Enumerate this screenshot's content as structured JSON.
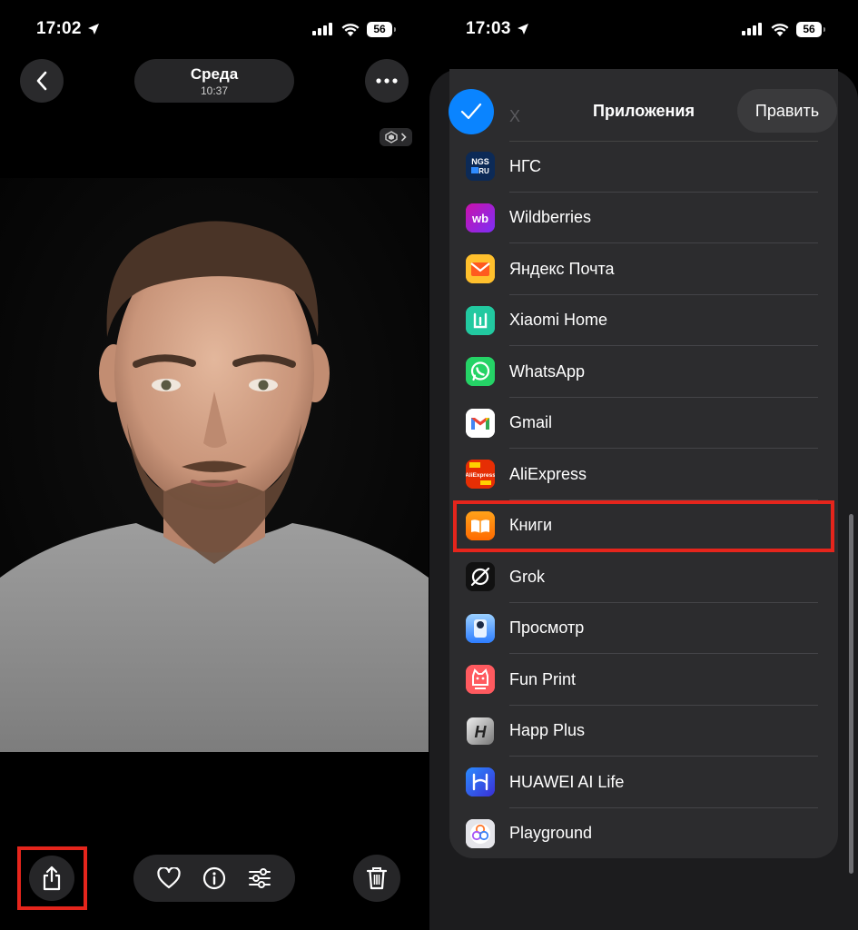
{
  "left_screen": {
    "status_time": "17:02",
    "battery": "56",
    "date_title": "Среда",
    "date_time": "10:37"
  },
  "right_screen": {
    "status_time": "17:03",
    "battery": "56",
    "sheet_title": "Приложения",
    "edit_label": "Править",
    "ghost_item": "X",
    "apps": [
      {
        "label": "НГС",
        "icon": "ngs-icon",
        "color": "#0c2a56"
      },
      {
        "label": "Wildberries",
        "icon": "wildberries-icon",
        "color": "#b01ec9"
      },
      {
        "label": "Яндекс Почта",
        "icon": "yandex-mail-icon",
        "color": "#ffb300"
      },
      {
        "label": "Xiaomi Home",
        "icon": "xiaomi-home-icon",
        "color": "#20c997"
      },
      {
        "label": "WhatsApp",
        "icon": "whatsapp-icon",
        "color": "#25d366"
      },
      {
        "label": "Gmail",
        "icon": "gmail-icon",
        "color": "#ffffff"
      },
      {
        "label": "AliExpress",
        "icon": "aliexpress-icon",
        "color": "#e62e04"
      },
      {
        "label": "Книги",
        "icon": "books-icon",
        "color": "#ff8a00"
      },
      {
        "label": "Grok",
        "icon": "grok-icon",
        "color": "#111111"
      },
      {
        "label": "Просмотр",
        "icon": "preview-icon",
        "color": "#5aa9ff"
      },
      {
        "label": "Fun Print",
        "icon": "fun-print-icon",
        "color": "#ff5a5f"
      },
      {
        "label": "Happ Plus",
        "icon": "happ-plus-icon",
        "color": "#3a3a3c"
      },
      {
        "label": "HUAWEI AI Life",
        "icon": "huawei-ai-life-icon",
        "color": "#1f6fff"
      },
      {
        "label": "Playground",
        "icon": "playground-icon",
        "color": "#e5e5ea"
      }
    ]
  },
  "colors": {
    "accent_blue": "#0a84ff",
    "highlight_red": "#e5251c"
  }
}
